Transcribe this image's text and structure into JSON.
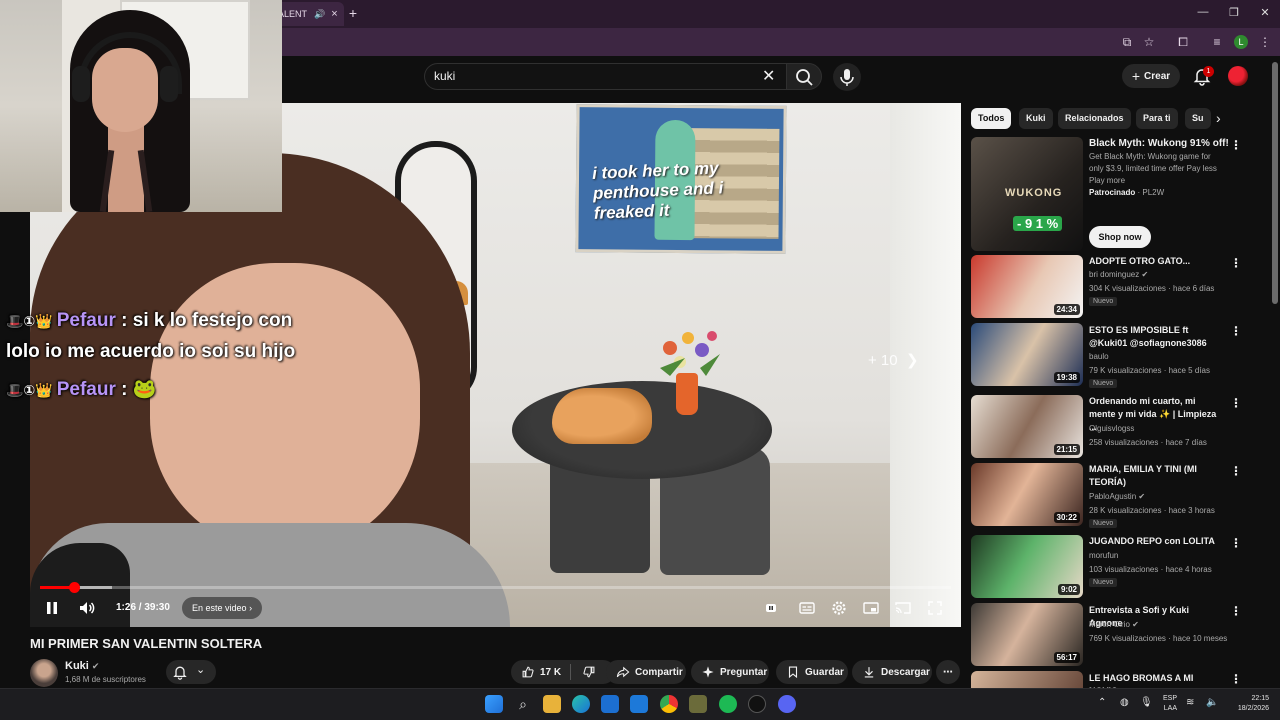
{
  "browser": {
    "tab_title": "ALENT",
    "tab_close": "×",
    "new_tab": "+"
  },
  "header": {
    "search_value": "kuki",
    "create_label": "Crear",
    "notification_count": "1"
  },
  "player": {
    "poster_caption": "i took her to my penthouse and i freaked it",
    "skip_label": "+ 10",
    "time": "1:26 / 39:30",
    "chapter_label": "En este video",
    "progress": 0.037,
    "buffered": 0.079,
    "chat": [
      {
        "user": "Pefaur",
        "text": ": si k lo festejo con"
      },
      {
        "user": "",
        "text": "lolo io me acuerdo io soi su hijo"
      },
      {
        "user": "Pefaur",
        "text": ":"
      }
    ]
  },
  "video": {
    "title": "MI PRIMER SAN VALENTIN SOLTERA",
    "channel": "Kuki",
    "subscribers": "1,68 M de suscriptores",
    "likes": "17 K",
    "share": "Compartir",
    "ask": "Preguntar",
    "save": "Guardar",
    "download": "Descargar"
  },
  "sidebar": {
    "chips": [
      "Todos",
      "Kuki",
      "Relacionados",
      "Para ti",
      "Su"
    ],
    "ad": {
      "title": "Black Myth: Wukong 91% off!",
      "description": "Get Black Myth: Wukong game for only $3.9, limited time offer Pay less Play more",
      "sponsored": "Patrocinado",
      "advertiser": "· PL2W",
      "thumb_logo": "WUKONG",
      "discount": "- 9 1 %",
      "cta": "Shop now"
    },
    "recommendations": [
      {
        "title": "ADOPTE OTRO GATO...",
        "channel": "bri dominguez",
        "verified": true,
        "meta": "304 K visualizaciones · hace 6 días",
        "badge": "Nuevo",
        "duration": "24:34"
      },
      {
        "title": "ESTO ES IMPOSIBLE ft @Kuki01 @sofiagnone3086",
        "channel": "baulo",
        "verified": false,
        "meta": "79 K visualizaciones · hace 5 días",
        "badge": "Nuevo",
        "duration": "19:38"
      },
      {
        "title": "Ordenando mi cuarto, mi mente y mi vida ✨ | Limpieza ...",
        "channel": "Olguisvlogss",
        "verified": false,
        "meta": "258 visualizaciones · hace 7 días",
        "badge": "",
        "duration": "21:15"
      },
      {
        "title": "MARIA, EMILIA Y TINI (MI TEORÍA)",
        "channel": "PabloAgustin",
        "verified": true,
        "meta": "28 K visualizaciones · hace 3 horas",
        "badge": "Nuevo",
        "duration": "30:22"
      },
      {
        "title": "JUGANDO REPO con LOLITA",
        "channel": "morufun",
        "verified": false,
        "meta": "103 visualizaciones · hace 4 horas",
        "badge": "Nuevo",
        "duration": "9:02"
      },
      {
        "title": "Entrevista a Sofi y Kuki Agnone",
        "channel": "Martin Cirio",
        "verified": true,
        "meta": "769 K visualizaciones · hace 10 meses",
        "badge": "",
        "duration": "56:17"
      },
      {
        "title": "LE HAGO BROMAS A MI NOVIO",
        "channel": "",
        "verified": false,
        "meta": "",
        "badge": "",
        "duration": ""
      }
    ]
  },
  "taskbar": {
    "lang": "ESP",
    "lang_sub": "LAA",
    "time": "22:15",
    "date": "18/2/2026"
  }
}
